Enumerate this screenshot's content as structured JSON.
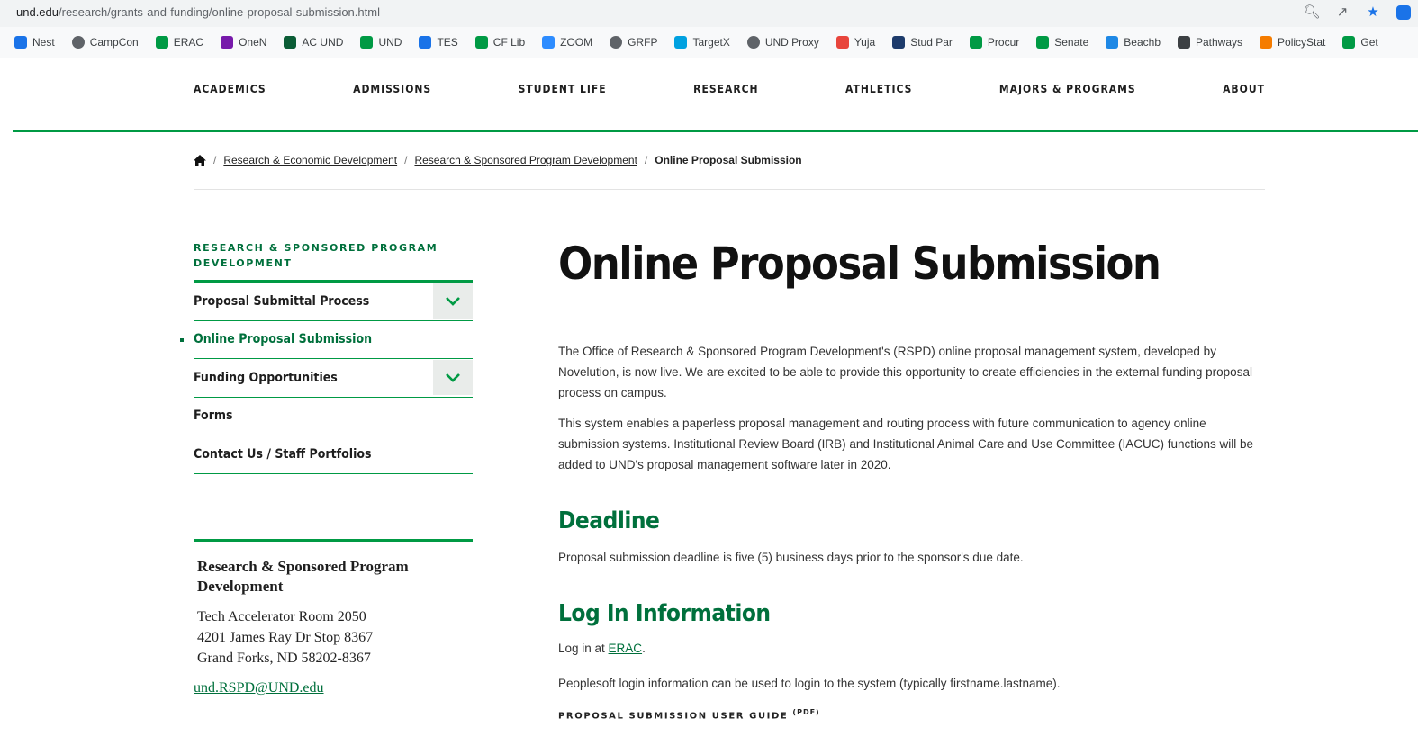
{
  "browser": {
    "url_domain": "und.edu",
    "url_path": "/research/grants-and-funding/online-proposal-submission.html",
    "bookmarks": [
      {
        "label": "Nest",
        "icon": "nest-icon",
        "color": "#1a73e8"
      },
      {
        "label": "CampCon",
        "icon": "globe-icon",
        "color": "#5f6368"
      },
      {
        "label": "ERAC",
        "icon": "und-icon",
        "color": "#009a44"
      },
      {
        "label": "OneN",
        "icon": "onenote-icon",
        "color": "#7719aa"
      },
      {
        "label": "AC UND",
        "icon": "und-icon",
        "color": "#0b5d36"
      },
      {
        "label": "UND",
        "icon": "und-icon",
        "color": "#009a44"
      },
      {
        "label": "TES",
        "icon": "layers-icon",
        "color": "#1a73e8"
      },
      {
        "label": "CF Lib",
        "icon": "und-icon",
        "color": "#009a44"
      },
      {
        "label": "ZOOM",
        "icon": "zoom-icon",
        "color": "#2d8cff"
      },
      {
        "label": "GRFP",
        "icon": "globe-icon",
        "color": "#5f6368"
      },
      {
        "label": "TargetX",
        "icon": "cloud-icon",
        "color": "#00a1e0"
      },
      {
        "label": "UND Proxy",
        "icon": "globe-icon",
        "color": "#5f6368"
      },
      {
        "label": "Yuja",
        "icon": "yuja-icon",
        "color": "#e8453c"
      },
      {
        "label": "Stud Par",
        "icon": "sis-icon",
        "color": "#1d3b6b"
      },
      {
        "label": "Procur",
        "icon": "und-icon",
        "color": "#009a44"
      },
      {
        "label": "Senate",
        "icon": "und-icon",
        "color": "#009a44"
      },
      {
        "label": "Beachb",
        "icon": "beachball-icon",
        "color": "#1e88e5"
      },
      {
        "label": "Pathways",
        "icon": "chart-icon",
        "color": "#3c4043"
      },
      {
        "label": "PolicyStat",
        "icon": "policystat-icon",
        "color": "#f57c00"
      },
      {
        "label": "Get",
        "icon": "und-icon",
        "color": "#009a44"
      }
    ]
  },
  "nav": {
    "items": [
      "ACADEMICS",
      "ADMISSIONS",
      "STUDENT LIFE",
      "RESEARCH",
      "ATHLETICS",
      "MAJORS & PROGRAMS",
      "ABOUT"
    ]
  },
  "breadcrumb": {
    "crumb1": "Research & Economic Development",
    "crumb2": "Research & Sponsored Program Development",
    "current": "Online Proposal Submission"
  },
  "sidebar": {
    "title": "RESEARCH & SPONSORED PROGRAM DEVELOPMENT",
    "items": [
      {
        "label": "Proposal Submittal Process",
        "expandable": true,
        "active": false
      },
      {
        "label": "Online Proposal Submission",
        "expandable": false,
        "active": true
      },
      {
        "label": "Funding Opportunities",
        "expandable": true,
        "active": false
      },
      {
        "label": "Forms",
        "expandable": false,
        "active": false
      },
      {
        "label": "Contact Us / Staff Portfolios",
        "expandable": false,
        "active": false
      }
    ],
    "contact": {
      "org": "Research & Sponsored Program Development",
      "addr1": "Tech Accelerator Room 2050",
      "addr2": "4201 James Ray Dr Stop 8367",
      "addr3": "Grand Forks, ND 58202-8367",
      "email": "und.RSPD@UND.edu"
    }
  },
  "main": {
    "title": "Online Proposal Submission",
    "intro1": "The Office of Research & Sponsored Program Development's (RSPD) online proposal management system, developed by Novelution, is now live. We are excited to be able to provide this opportunity to create efficiencies in the external funding proposal process on campus.",
    "intro2": "This system enables a paperless proposal management and routing process with future communication to agency online submission systems. Institutional Review Board (IRB) and Institutional Animal Care and Use Committee (IACUC) functions will be added to UND's proposal management software later in 2020.",
    "deadline_heading": "Deadline",
    "deadline_text": "Proposal submission deadline is five (5) business days prior to the sponsor's due date.",
    "login_heading": "Log In Information",
    "login_prefix": "Log in at ",
    "login_link": "ERAC",
    "login_suffix": ".",
    "login_note": "Peoplesoft login information can be used to login to the system (typically firstname.lastname).",
    "guide_label": "PROPOSAL SUBMISSION USER GUIDE",
    "guide_type": "(PDF)"
  },
  "colors": {
    "accent_green": "#009a44",
    "dark_green": "#00703c"
  }
}
